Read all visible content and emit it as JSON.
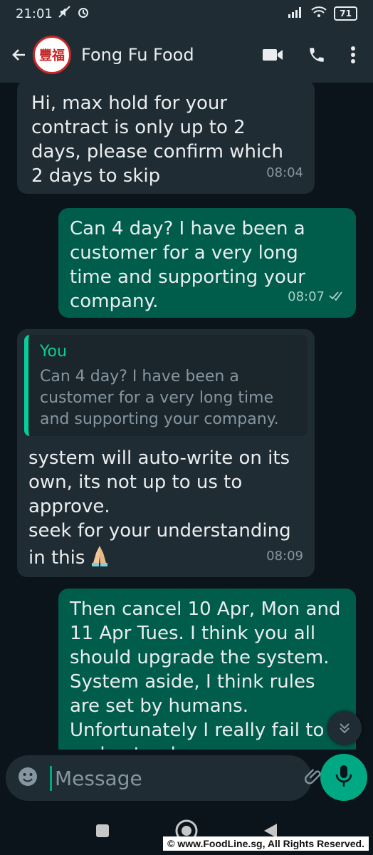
{
  "status_bar": {
    "time": "21:01",
    "battery": "71"
  },
  "header": {
    "contact_name": "Fong Fu Food",
    "avatar_text": "豐福"
  },
  "messages": [
    {
      "direction": "incoming",
      "text": "Hi, max hold for your contract is only up to 2 days, please confirm which 2 days to skip",
      "time": "08:04"
    },
    {
      "direction": "outgoing",
      "text": "Can 4 day? I have been a customer for a very long time and supporting your company.",
      "time": "08:07"
    },
    {
      "direction": "incoming",
      "quote_author": "You",
      "quote_text": "Can 4 day? I have been a customer for a very long time and supporting your company.",
      "text": "system will auto-write on its own, its not up to us to approve.\nseek for your understanding in this",
      "time": "08:09"
    },
    {
      "direction": "outgoing",
      "text": "Then cancel 10 Apr, Mon and 11 Apr Tues. I think you all should upgrade the system. System aside, I think rules are set by humans. Unfortunately I really fail to understand."
    }
  ],
  "composer": {
    "placeholder": "Message"
  },
  "watermark": "© www.FoodLine.sg, All Rights Reserved.",
  "colors": {
    "accent": "#00a884",
    "outgoing_bubble": "#005c4b",
    "incoming_bubble": "#202c33",
    "app_bar": "#1f2c34"
  }
}
